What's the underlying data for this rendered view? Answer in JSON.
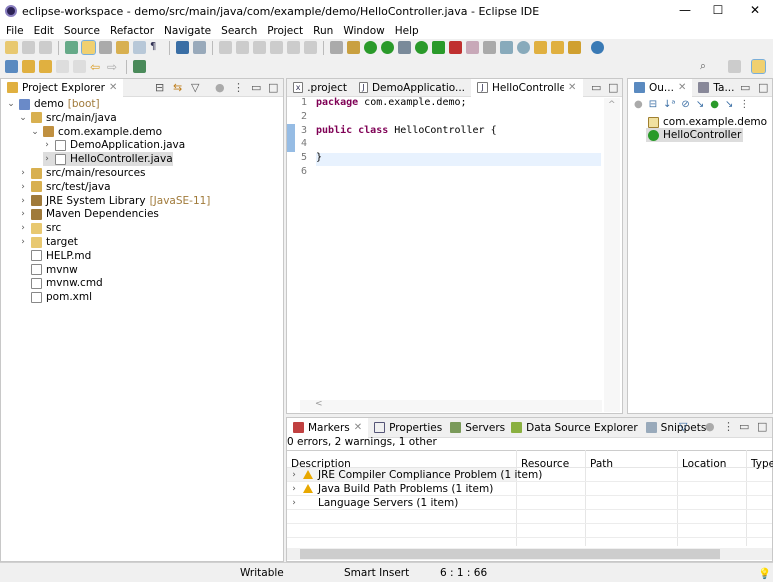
{
  "window": {
    "title": "eclipse-workspace - demo/src/main/java/com/example/demo/HelloController.java - Eclipse IDE",
    "minimize": "—",
    "maximize": "☐",
    "close": "✕"
  },
  "menu": [
    "File",
    "Edit",
    "Source",
    "Refactor",
    "Navigate",
    "Search",
    "Project",
    "Run",
    "Window",
    "Help"
  ],
  "project_explorer": {
    "title": "Project Explorer",
    "items": [
      {
        "label": "demo",
        "decoration": "[boot]",
        "level": 0,
        "expanded": true,
        "icon": "project-icon"
      },
      {
        "label": "src/main/java",
        "level": 1,
        "expanded": true,
        "icon": "source-folder-icon"
      },
      {
        "label": "com.example.demo",
        "level": 2,
        "expanded": true,
        "icon": "package-icon"
      },
      {
        "label": "DemoApplication.java",
        "level": 3,
        "expanded": false,
        "icon": "java-file-icon"
      },
      {
        "label": "HelloController.java",
        "level": 3,
        "expanded": false,
        "icon": "java-file-icon",
        "selected": true
      },
      {
        "label": "src/main/resources",
        "level": 1,
        "expanded": false,
        "icon": "source-folder-icon"
      },
      {
        "label": "src/test/java",
        "level": 1,
        "expanded": false,
        "icon": "source-folder-icon"
      },
      {
        "label": "JRE System Library",
        "decoration": "[JavaSE-11]",
        "level": 1,
        "expanded": false,
        "icon": "library-icon"
      },
      {
        "label": "Maven Dependencies",
        "level": 1,
        "expanded": false,
        "icon": "library-icon"
      },
      {
        "label": "src",
        "level": 1,
        "expanded": false,
        "icon": "folder-icon"
      },
      {
        "label": "target",
        "level": 1,
        "expanded": false,
        "icon": "folder-icon"
      },
      {
        "label": "HELP.md",
        "level": 1,
        "icon": "file-icon"
      },
      {
        "label": "mvnw",
        "level": 1,
        "icon": "file-icon"
      },
      {
        "label": "mvnw.cmd",
        "level": 1,
        "icon": "file-icon"
      },
      {
        "label": "pom.xml",
        "level": 1,
        "icon": "xml-file-icon"
      }
    ]
  },
  "editor": {
    "tabs": [
      {
        "label": ".project",
        "icon": "x"
      },
      {
        "label": "DemoApplicatio...",
        "icon": "J"
      },
      {
        "label": "HelloController....",
        "icon": "J",
        "active": true
      }
    ],
    "lines": [
      {
        "num": "1",
        "kw": "package",
        "rest": " com.example.demo;"
      },
      {
        "num": "2",
        "kw": "",
        "rest": ""
      },
      {
        "num": "3",
        "kw": "public class",
        "rest": " HelloController {"
      },
      {
        "num": "4",
        "kw": "",
        "rest": ""
      },
      {
        "num": "5",
        "kw": "",
        "rest": "}"
      },
      {
        "num": "6",
        "kw": "",
        "rest": ""
      }
    ]
  },
  "outline": {
    "tabs": [
      {
        "label": "Ou..."
      },
      {
        "label": "Ta..."
      }
    ],
    "items": [
      {
        "label": "com.example.demo",
        "icon": "package-icon"
      },
      {
        "label": "HelloController",
        "icon": "class-icon",
        "selected": true
      }
    ]
  },
  "bottom": {
    "tabs": [
      {
        "label": "Markers",
        "active": true
      },
      {
        "label": "Properties"
      },
      {
        "label": "Servers"
      },
      {
        "label": "Data Source Explorer"
      },
      {
        "label": "Snippets"
      }
    ],
    "summary": "0 errors, 2 warnings, 1 other",
    "columns": [
      "Description",
      "Resource",
      "Path",
      "Location",
      "Type"
    ],
    "rows": [
      {
        "label": "JRE Compiler Compliance Problem (1 item)",
        "warning": true
      },
      {
        "label": "Java Build Path Problems (1 item)",
        "warning": true
      },
      {
        "label": "Language Servers (1 item)",
        "warning": false
      }
    ]
  },
  "status": {
    "writable": "Writable",
    "insert": "Smart Insert",
    "position": "6 : 1 : 66"
  }
}
